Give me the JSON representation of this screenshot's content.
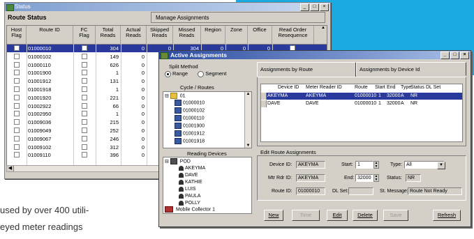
{
  "status_window": {
    "title": "Status",
    "heading": "Route Status",
    "manage_tab": "Manage Assignments",
    "columns": [
      "Host\nFlag",
      "Route ID",
      "FC\nFlag",
      "Total\nReads",
      "Actual\nReads",
      "Skipped\nReads",
      "Missed\nReads",
      "Region",
      "Zone",
      "Office",
      "Read Order\nResequence"
    ],
    "rows": [
      {
        "route_id": "01000010",
        "total": "304",
        "actual": "0",
        "skipped": "0",
        "missed": "304",
        "region": "0",
        "zone": "0",
        "office": "0"
      },
      {
        "route_id": "01000102",
        "total": "149",
        "actual": "0"
      },
      {
        "route_id": "01000110",
        "total": "626",
        "actual": "0"
      },
      {
        "route_id": "01001900",
        "total": "1",
        "actual": "0"
      },
      {
        "route_id": "01001912",
        "total": "131",
        "actual": "0"
      },
      {
        "route_id": "01001918",
        "total": "1",
        "actual": "0"
      },
      {
        "route_id": "01001920",
        "total": "221",
        "actual": "0"
      },
      {
        "route_id": "01002922",
        "total": "66",
        "actual": "0"
      },
      {
        "route_id": "01002950",
        "total": "1",
        "actual": "0"
      },
      {
        "route_id": "01009036",
        "total": "215",
        "actual": "0"
      },
      {
        "route_id": "01009049",
        "total": "252",
        "actual": "0"
      },
      {
        "route_id": "01009067",
        "total": "246",
        "actual": "0"
      },
      {
        "route_id": "01009102",
        "total": "312",
        "actual": "0"
      },
      {
        "route_id": "01009110",
        "total": "396",
        "actual": "0"
      }
    ]
  },
  "active_window": {
    "title": "Active Assignments",
    "split_method": "Split Method",
    "range": "Range",
    "segment": "Segment",
    "cycle_label": "Cycle / Routes",
    "cycle_root": "01",
    "cycle_items": [
      "01000010",
      "01000102",
      "01000110",
      "01001900",
      "01001912",
      "01001918"
    ],
    "reading_devices_label": "Reading Devices",
    "device_root": "POD",
    "devices": [
      "AKEYMA",
      "DAVE",
      "KATHIE",
      "LUIS",
      "PAULA",
      "POLLY"
    ],
    "mobile_collector": "Mobile Collector 1",
    "tab_route": "Assignments by Route",
    "tab_device": "Assignments by Device Id",
    "assign_columns": [
      "Device ID",
      "Meter Reader ID",
      "Route",
      "Start",
      "End",
      "Type",
      "Status",
      "DL Set"
    ],
    "assign_rows": [
      {
        "device": "AKEYMA",
        "reader": "AKEYMA",
        "route": "01000010",
        "start": "1",
        "end": "32000",
        "type": "A",
        "status": "NR"
      },
      {
        "device": "DAVE",
        "reader": "DAVE",
        "route": "01000010",
        "start": "1",
        "end": "32000",
        "type": "A",
        "status": "NR"
      }
    ],
    "edit_label": "Edit Route Assignments",
    "device_id_label": "Device ID:",
    "device_id_value": "AKEYMA",
    "start_label": "Start:",
    "start_value": "1",
    "type_label": "Type:",
    "type_value": "All",
    "mtr_label": "Mtr Rdr ID:",
    "mtr_value": "AKEYMA",
    "end_label": "End:",
    "end_value": "32000",
    "status_label": "Status:",
    "status_value": "NR",
    "route_id_label": "Route ID:",
    "route_id_value": "01000010",
    "dlset_label": "DL Set:",
    "st_msg_label": "St. Message:",
    "st_msg_value": "Route Not Ready",
    "buttons": {
      "new": "New",
      "time": "Time",
      "edit": "Edit",
      "delete": "Delete",
      "save": "Save",
      "refresh": "Refresh"
    }
  },
  "page_text": {
    "line1": "used by over 400 utili-",
    "line2": "eyed meter readings"
  }
}
